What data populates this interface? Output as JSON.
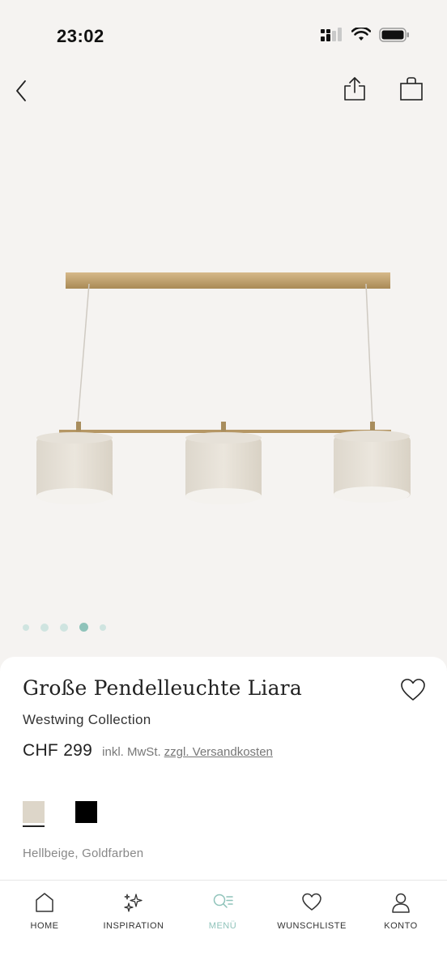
{
  "status_bar": {
    "time": "23:02"
  },
  "product": {
    "title": "Große Pendelleuchte Liara",
    "brand": "Westwing Collection",
    "price": "CHF 299",
    "tax_note": "inkl. MwSt.",
    "shipping_link": "zzgl. Versandkosten",
    "color_name": "Hellbeige, Goldfarben"
  },
  "gallery": {
    "dot_count": 5,
    "active_index": 3
  },
  "swatches": [
    {
      "color": "#ddd6c9",
      "selected": true
    },
    {
      "color": "#000000",
      "selected": false
    }
  ],
  "colors": {
    "accent": "#8fc3ba",
    "sheet": "#ffffff",
    "background": "#f5f3f1"
  },
  "tabs": [
    {
      "label": "HOME",
      "icon": "home-icon",
      "active": false
    },
    {
      "label": "INSPIRATION",
      "icon": "sparkles-icon",
      "active": false
    },
    {
      "label": "MENÜ",
      "icon": "search-menu-icon",
      "active": true
    },
    {
      "label": "WUNSCHLISTE",
      "icon": "heart-icon",
      "active": false
    },
    {
      "label": "KONTO",
      "icon": "user-icon",
      "active": false
    }
  ]
}
